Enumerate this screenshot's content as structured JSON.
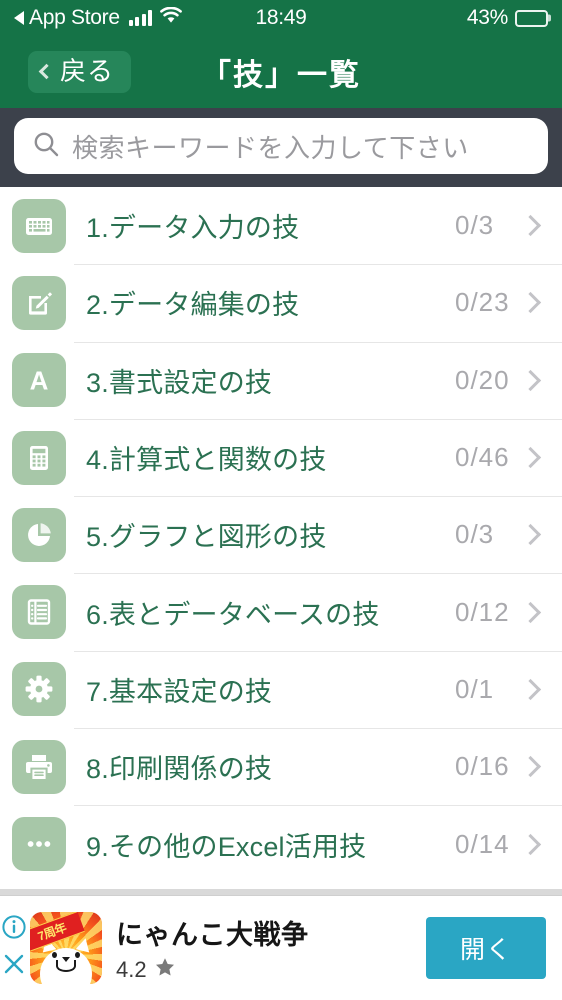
{
  "status_bar": {
    "carrier_back_label": "App Store",
    "back_arrow_icon": "triangle-left-icon",
    "signal_icon": "cellular-signal-icon",
    "wifi_icon": "wifi-icon",
    "time": "18:49",
    "battery_percent": "43%",
    "battery_icon": "battery-icon",
    "battery_level": 43
  },
  "nav_bar": {
    "back_label": "戻る",
    "back_chevron_icon": "chevron-left-icon",
    "title": "「技」一覧"
  },
  "search": {
    "placeholder": "検索キーワードを入力して下さい",
    "value": "",
    "icon": "search-icon"
  },
  "list": {
    "items": [
      {
        "label": "1.データ入力の技",
        "count": "0/3",
        "icon": "keyboard-icon",
        "chevron": "chevron-right-icon"
      },
      {
        "label": "2.データ編集の技",
        "count": "0/23",
        "icon": "edit-square-icon",
        "chevron": "chevron-right-icon"
      },
      {
        "label": "3.書式設定の技",
        "count": "0/20",
        "icon": "letter-a-icon",
        "chevron": "chevron-right-icon"
      },
      {
        "label": "4.計算式と関数の技",
        "count": "0/46",
        "icon": "calculator-icon",
        "chevron": "chevron-right-icon"
      },
      {
        "label": "5.グラフと図形の技",
        "count": "0/3",
        "icon": "pie-chart-icon",
        "chevron": "chevron-right-icon"
      },
      {
        "label": "6.表とデータベースの技",
        "count": "0/12",
        "icon": "table-list-icon",
        "chevron": "chevron-right-icon"
      },
      {
        "label": "7.基本設定の技",
        "count": "0/1",
        "icon": "gear-icon",
        "chevron": "chevron-right-icon"
      },
      {
        "label": "8.印刷関係の技",
        "count": "0/16",
        "icon": "printer-icon",
        "chevron": "chevron-right-icon"
      },
      {
        "label": "9.その他のExcel活用技",
        "count": "0/14",
        "icon": "ellipsis-icon",
        "chevron": "chevron-right-icon"
      }
    ]
  },
  "ad": {
    "info_icon": "info-circle-icon",
    "close_icon": "close-icon",
    "app_icon": "battle-cats-app-icon",
    "app_icon_badge": "7周年",
    "title": "にゃんこ大戦争",
    "rating": "4.2",
    "star_icon": "star-icon",
    "cta_label": "開く"
  },
  "colors": {
    "nav_green": "#157347",
    "search_bar_dark": "#3c414b",
    "item_label_green": "#2b7152",
    "item_icon_tile": "#a7c7a8",
    "count_gray": "#a9a9ad",
    "ad_cta_teal": "#2aa6c4",
    "ad_control_teal": "#2aa6c4"
  }
}
